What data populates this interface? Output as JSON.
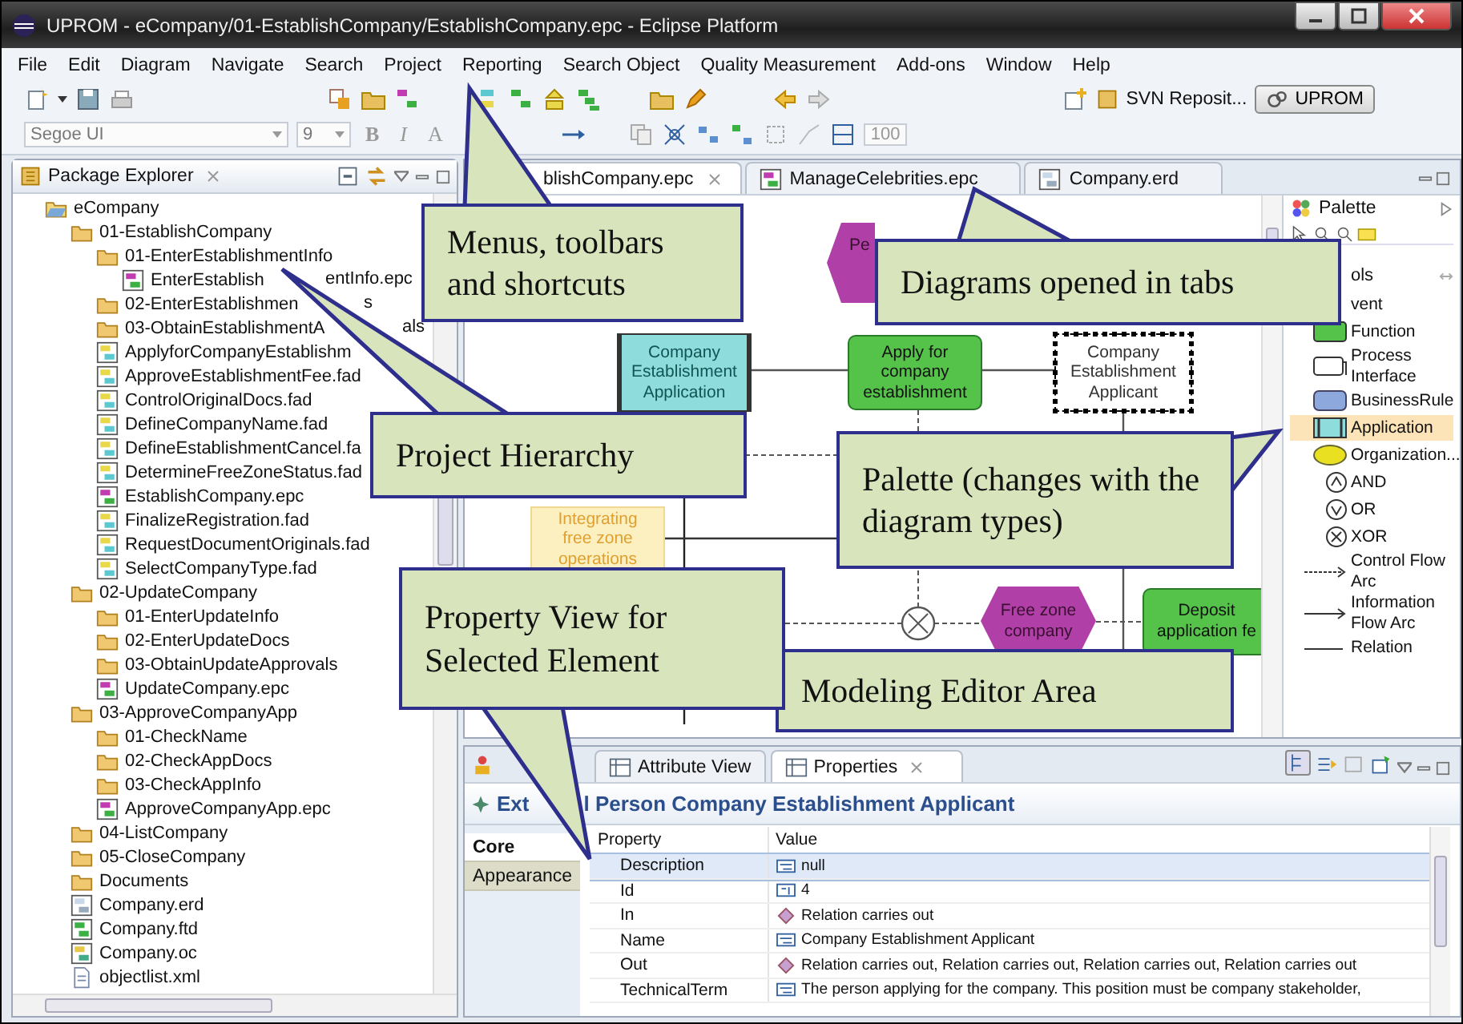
{
  "window": {
    "title": "UPROM - eCompany/01-EstablishCompany/EstablishCompany.epc - Eclipse Platform"
  },
  "menu": [
    "File",
    "Edit",
    "Diagram",
    "Navigate",
    "Search",
    "Project",
    "Reporting",
    "Search Object",
    "Quality Measurement",
    "Add-ons",
    "Window",
    "Help"
  ],
  "toolbar": {
    "font": "Segoe UI",
    "size": "9",
    "bold": "B",
    "italic": "I",
    "font_color": "A",
    "zoom": "100",
    "svn": "SVN Reposit...",
    "perspective": "UPROM"
  },
  "package_explorer": {
    "title": "Package Explorer",
    "tree": [
      {
        "label": "eCompany",
        "kind": "project",
        "children": [
          {
            "label": "01-EstablishCompany",
            "kind": "folder",
            "children": [
              {
                "label": "01-EnterEstablishmentInfo",
                "kind": "folder",
                "children": [
                  {
                    "label": "EnterEstablish",
                    "label_after": "entInfo.epc",
                    "kind": "epc"
                  }
                ]
              },
              {
                "label": "02-EnterEstablishmen",
                "label_after": "s",
                "kind": "folder"
              },
              {
                "label": "03-ObtainEstablishmentA",
                "label_after": "als",
                "kind": "folder"
              },
              {
                "label": "ApplyforCompanyEstablishm",
                "kind": "fad"
              },
              {
                "label": "ApproveEstablishmentFee.fad",
                "kind": "fad"
              },
              {
                "label": "ControlOriginalDocs.fad",
                "kind": "fad"
              },
              {
                "label": "DefineCompanyName.fad",
                "kind": "fad"
              },
              {
                "label": "DefineEstablishmentCancel.fa",
                "kind": "fad"
              },
              {
                "label": "DetermineFreeZoneStatus.fad",
                "kind": "fad"
              },
              {
                "label": "EstablishCompany.epc",
                "kind": "epc"
              },
              {
                "label": "FinalizeRegistration.fad",
                "kind": "fad"
              },
              {
                "label": "RequestDocumentOriginals.fad",
                "kind": "fad"
              },
              {
                "label": "SelectCompanyType.fad",
                "kind": "fad"
              }
            ]
          },
          {
            "label": "02-UpdateCompany",
            "kind": "folder",
            "children": [
              {
                "label": "01-EnterUpdateInfo",
                "kind": "folder"
              },
              {
                "label": "02-EnterUpdateDocs",
                "kind": "folder"
              },
              {
                "label": "03-ObtainUpdateApprovals",
                "kind": "folder"
              },
              {
                "label": "UpdateCompany.epc",
                "kind": "epc"
              }
            ]
          },
          {
            "label": "03-ApproveCompanyApp",
            "kind": "folder",
            "children": [
              {
                "label": "01-CheckName",
                "kind": "folder"
              },
              {
                "label": "02-CheckAppDocs",
                "kind": "folder"
              },
              {
                "label": "03-CheckAppInfo",
                "kind": "folder"
              },
              {
                "label": "ApproveCompanyApp.epc",
                "kind": "epc"
              }
            ]
          },
          {
            "label": "04-ListCompany",
            "kind": "folder"
          },
          {
            "label": "05-CloseCompany",
            "kind": "folder"
          },
          {
            "label": "Documents",
            "kind": "folder"
          },
          {
            "label": "Company.erd",
            "kind": "erd"
          },
          {
            "label": "Company.ftd",
            "kind": "ftd"
          },
          {
            "label": "Company.oc",
            "kind": "oc"
          },
          {
            "label": "objectlist.xml",
            "kind": "xml"
          }
        ]
      }
    ]
  },
  "editor_tabs": [
    {
      "label": "blishCompany.epc",
      "selected": true
    },
    {
      "label": "ManageCelebrities.epc",
      "kind": "epc",
      "selected": false
    },
    {
      "label": "Company.erd",
      "kind": "erd",
      "selected": false
    }
  ],
  "diagram": {
    "nodes": [
      {
        "label": "Pe",
        "kind": "event",
        "selected": false
      },
      {
        "label": "Company Establishment Application",
        "kind": "application",
        "selected": false
      },
      {
        "label": "Apply for company establishment",
        "kind": "function",
        "selected": false
      },
      {
        "label": "Company Establishment Applicant",
        "kind": "organization",
        "selected": true
      },
      {
        "label": "Integrating free zone operations",
        "kind": "goal",
        "selected": false
      },
      {
        "label": "Free zone company",
        "kind": "event",
        "selected": false
      },
      {
        "label": "Deposit application fe",
        "kind": "function",
        "selected": false
      }
    ]
  },
  "palette": {
    "title": "Palette",
    "group": "ols",
    "items": [
      {
        "label": "vent",
        "kind": "event",
        "selected": false
      },
      {
        "label": "Function",
        "kind": "function",
        "selected": false
      },
      {
        "label": "Process Interface",
        "kind": "interface",
        "selected": false
      },
      {
        "label": "BusinessRule",
        "kind": "rule",
        "selected": false
      },
      {
        "label": "Application",
        "kind": "application",
        "selected": true
      },
      {
        "label": "Organization...",
        "kind": "organization",
        "selected": false
      },
      {
        "label": "AND",
        "kind": "and",
        "selected": false
      },
      {
        "label": "OR",
        "kind": "or",
        "selected": false
      },
      {
        "label": "XOR",
        "kind": "xor",
        "selected": false
      },
      {
        "label": "Control Flow Arc",
        "kind": "control-arc",
        "selected": false
      },
      {
        "label": "Information Flow Arc",
        "kind": "info-arc",
        "selected": false
      },
      {
        "label": "Relation",
        "kind": "relation",
        "selected": false
      }
    ]
  },
  "properties": {
    "tabs": [
      {
        "label": "Attribute View",
        "selected": false
      },
      {
        "label": "Properties",
        "selected": true
      }
    ],
    "title": "Ext",
    "title_end": "l Person Company Establishment Applicant",
    "sections": [
      {
        "label": "Core",
        "selected": true
      },
      {
        "label": "Appearance",
        "selected": false
      }
    ],
    "columns": [
      "Property",
      "Value"
    ],
    "rows": [
      {
        "property": "Description",
        "value": "null",
        "kind": "text",
        "selected": true
      },
      {
        "property": "Id",
        "value": "4",
        "kind": "id",
        "selected": false
      },
      {
        "property": "In",
        "value": "Relation carries out",
        "kind": "relation",
        "selected": false
      },
      {
        "property": "Name",
        "value": "Company Establishment Applicant",
        "kind": "text",
        "selected": false
      },
      {
        "property": "Out",
        "value": "Relation carries out, Relation carries out, Relation carries out, Relation carries out",
        "kind": "relation",
        "selected": false
      },
      {
        "property": "TechnicalTerm",
        "value": "The person applying for the company. This position must be company stakeholder,",
        "kind": "text",
        "selected": false
      }
    ]
  },
  "callouts": [
    {
      "text": "Menus, toolbars and shortcuts"
    },
    {
      "text": "Diagrams opened in tabs"
    },
    {
      "text": "Project Hierarchy"
    },
    {
      "text": "Palette (changes with the diagram types)"
    },
    {
      "text": "Modeling Editor Area"
    },
    {
      "text": "Property View for Selected Element"
    }
  ]
}
